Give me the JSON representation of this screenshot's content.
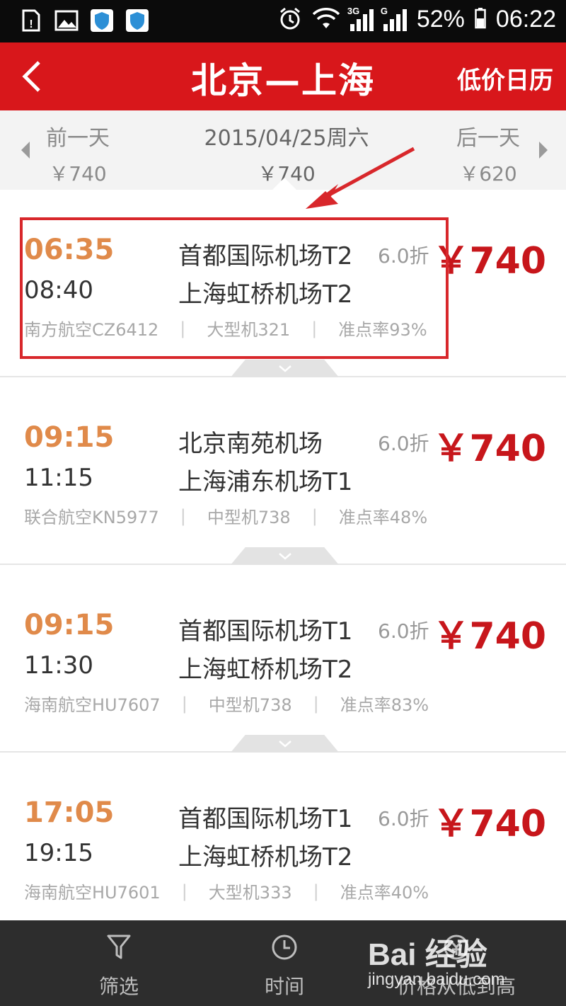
{
  "status_bar": {
    "battery": "52%",
    "time": "06:22",
    "net_label_1": "3G",
    "net_label_2": "G"
  },
  "header": {
    "title": "北京—上海",
    "action": "低价日历"
  },
  "date_bar": {
    "prev": {
      "label": "前一天",
      "price": "￥740"
    },
    "current": {
      "label": "2015/04/25周六",
      "price": "￥740"
    },
    "next": {
      "label": "后一天",
      "price": "￥620"
    }
  },
  "flights": [
    {
      "dep_time": "06:35",
      "arr_time": "08:40",
      "dep_airport": "首都国际机场T2",
      "arr_airport": "上海虹桥机场T2",
      "discount": "6.0折",
      "price": "￥740",
      "airline": "南方航空CZ6412",
      "aircraft": "大型机321",
      "on_time": "准点率93%"
    },
    {
      "dep_time": "09:15",
      "arr_time": "11:15",
      "dep_airport": "北京南苑机场",
      "arr_airport": "上海浦东机场T1",
      "discount": "6.0折",
      "price": "￥740",
      "airline": "联合航空KN5977",
      "aircraft": "中型机738",
      "on_time": "准点率48%"
    },
    {
      "dep_time": "09:15",
      "arr_time": "11:30",
      "dep_airport": "首都国际机场T1",
      "arr_airport": "上海虹桥机场T2",
      "discount": "6.0折",
      "price": "￥740",
      "airline": "海南航空HU7607",
      "aircraft": "中型机738",
      "on_time": "准点率83%"
    },
    {
      "dep_time": "17:05",
      "arr_time": "19:15",
      "dep_airport": "首都国际机场T1",
      "arr_airport": "上海虹桥机场T2",
      "discount": "6.0折",
      "price": "￥740",
      "airline": "海南航空HU7601",
      "aircraft": "大型机333",
      "on_time": "准点率40%"
    }
  ],
  "bottom_nav": {
    "filter": "筛选",
    "time": "时间",
    "price": "价格从低到高"
  },
  "watermark": {
    "brand": "Bai 经验",
    "url": "jingyan.baidu.com"
  },
  "colors": {
    "header": "#d8171b",
    "price": "#c7161b",
    "dep_time": "#e08a4a",
    "highlight": "#d8272b"
  }
}
